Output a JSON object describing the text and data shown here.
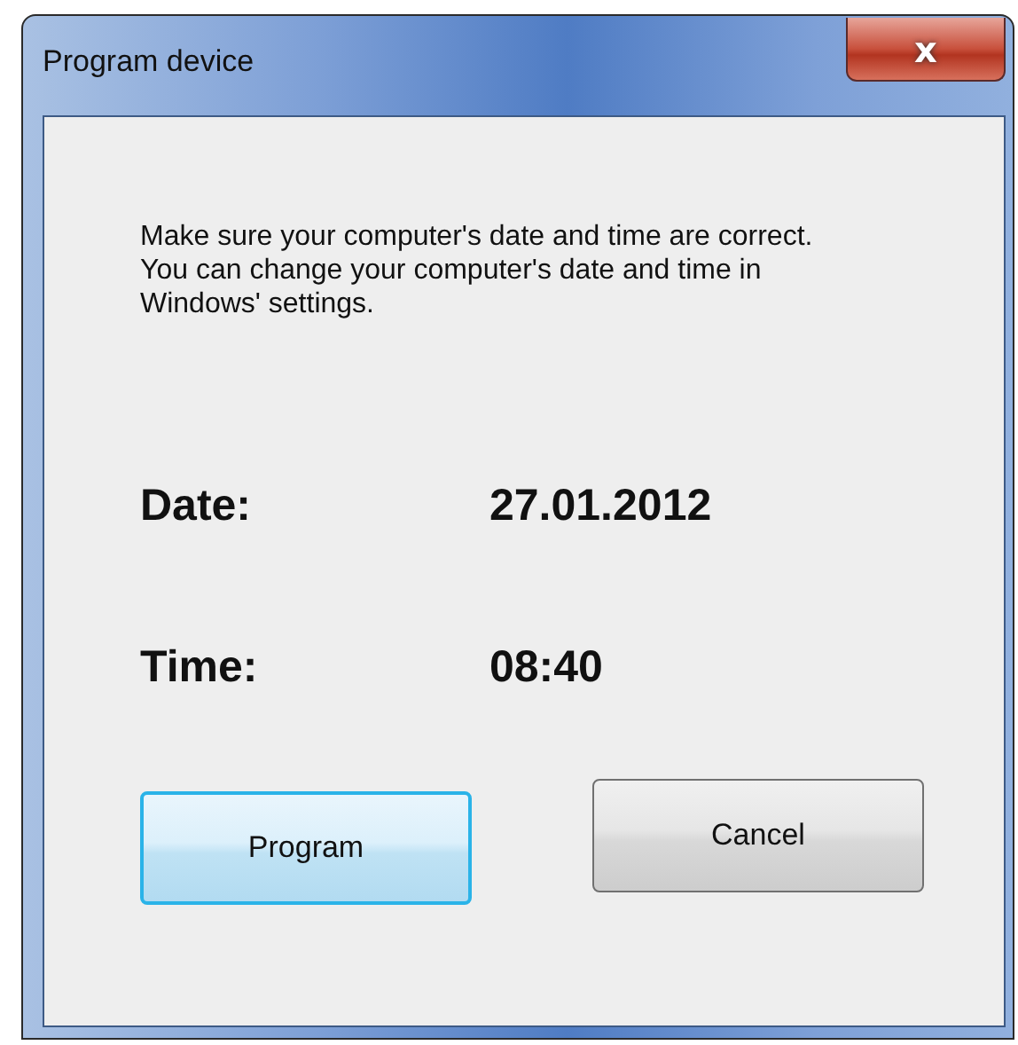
{
  "window": {
    "title": "Program device",
    "close": "x"
  },
  "message": "Make sure your computer's date and time are correct. You can change your computer's date and time in Windows' settings.",
  "fields": [
    {
      "label": "Date:",
      "value": "27.01.2012"
    },
    {
      "label": "Time:",
      "value": "08:40"
    }
  ],
  "buttons": [
    {
      "label": "Program",
      "focused": true
    },
    {
      "label": "Cancel",
      "focused": false
    }
  ]
}
